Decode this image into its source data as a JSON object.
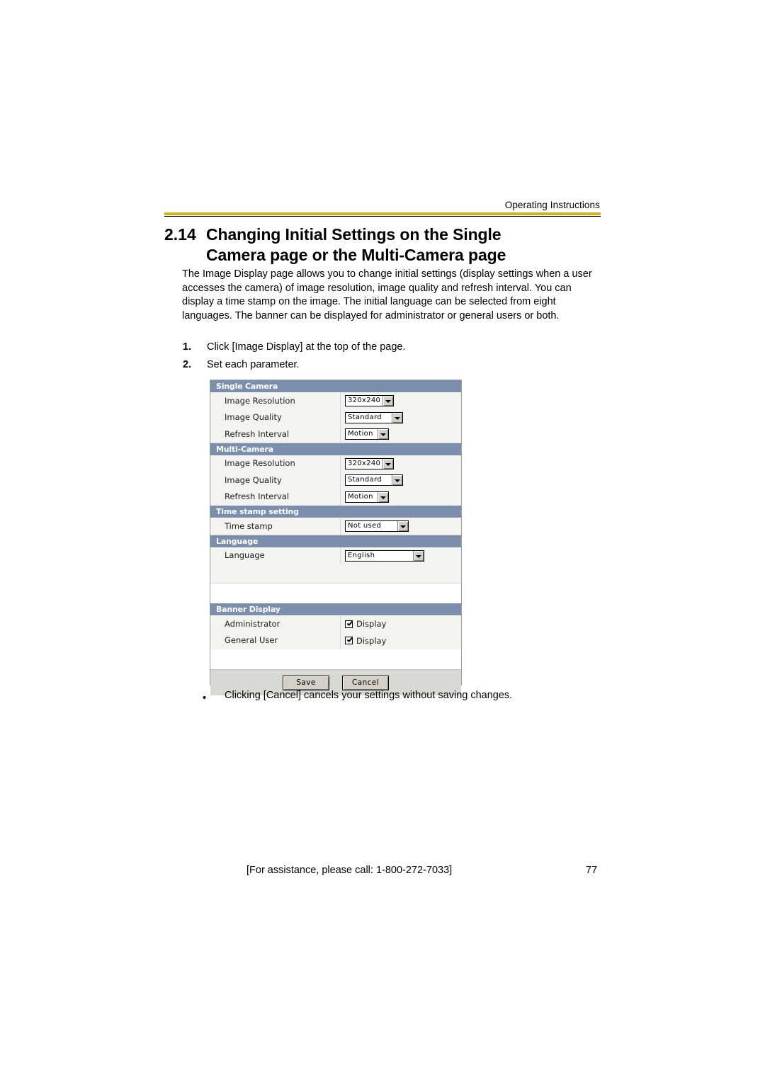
{
  "header": {
    "running_head": "Operating Instructions"
  },
  "title": {
    "number": "2.14",
    "line1": "Changing Initial Settings on the Single",
    "line2": "Camera page or the Multi-Camera page"
  },
  "intro_paragraph": "The Image Display page allows you to change initial settings (display settings when a user accesses the camera) of image resolution, image quality and refresh interval. You can display a time stamp on the image. The initial language can be selected from eight languages. The banner can be displayed for administrator or general users or both.",
  "steps": [
    {
      "num": "1.",
      "text": "Click [Image Display] at the top of the page."
    },
    {
      "num": "2.",
      "text": "Set each parameter."
    }
  ],
  "screenshot": {
    "sections": [
      {
        "title": "Single Camera",
        "rows": [
          {
            "label": "Image Resolution",
            "control": "select",
            "value": "320x240"
          },
          {
            "label": "Image Quality",
            "control": "select",
            "value": "Standard"
          },
          {
            "label": "Refresh Interval",
            "control": "select",
            "value": "Motion"
          }
        ]
      },
      {
        "title": "Multi-Camera",
        "rows": [
          {
            "label": "Image Resolution",
            "control": "select",
            "value": "320x240"
          },
          {
            "label": "Image Quality",
            "control": "select",
            "value": "Standard"
          },
          {
            "label": "Refresh Interval",
            "control": "select",
            "value": "Motion"
          }
        ]
      },
      {
        "title": "Time stamp setting",
        "rows": [
          {
            "label": "Time stamp",
            "control": "select",
            "value": "Not used"
          }
        ]
      },
      {
        "title": "Language",
        "rows": [
          {
            "label": "Language",
            "control": "select",
            "value": "English"
          }
        ]
      },
      {
        "title": "Banner Display",
        "rows": [
          {
            "label": "Administrator",
            "control": "checkbox",
            "value": "Display",
            "checked": true
          },
          {
            "label": "General User",
            "control": "checkbox",
            "value": "Display",
            "checked": true
          }
        ]
      }
    ],
    "buttons": {
      "save": "Save",
      "cancel": "Cancel"
    }
  },
  "bullet": {
    "marker": "•",
    "text": "Clicking [Cancel] cancels your settings without saving changes."
  },
  "footer": {
    "assistance": "[For assistance, please call: 1-800-272-7033]",
    "page_number": "77"
  },
  "colors": {
    "rule": "#d2b21a",
    "section_header": "#7b8fad",
    "field_bg": "#f3f3f1"
  }
}
